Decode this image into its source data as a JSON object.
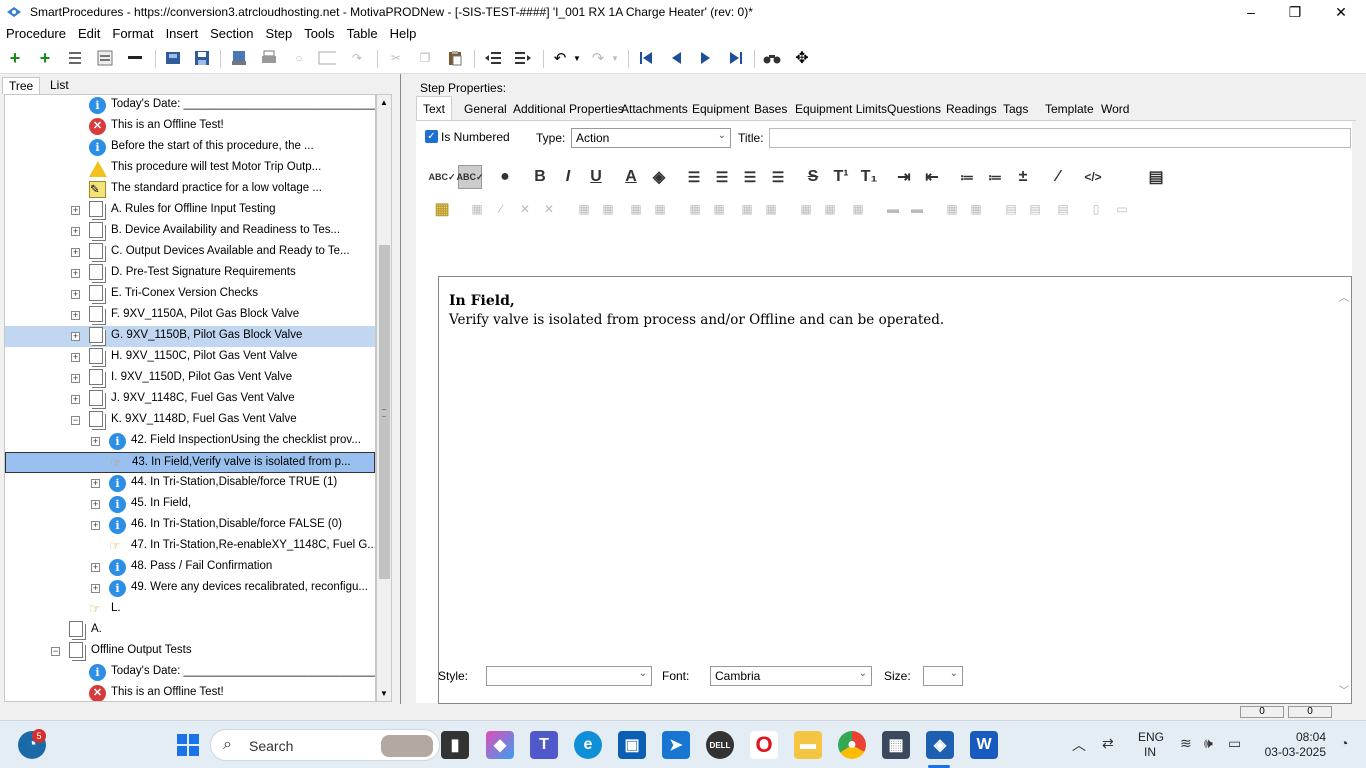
{
  "window": {
    "title": "SmartProcedures - https://conversion3.atrcloudhosting.net - MotivaPRODNew - [-SIS-TEST-####] 'I_001 RX 1A Charge Heater' (rev: 0)*",
    "minimize": "–",
    "restore": "❐",
    "close": "✕"
  },
  "menu": [
    "Procedure",
    "Edit",
    "Format",
    "Insert",
    "Section",
    "Step",
    "Tools",
    "Table",
    "Help"
  ],
  "toolbar_icons": [
    "add-icon",
    "add-child-icon",
    "outdent-icon",
    "properties-icon",
    "delete-icon",
    "open-icon",
    "save-icon",
    "export-icon",
    "print-icon",
    "refresh-icon",
    "image-icon",
    "redo-icon",
    "cut-icon",
    "copy-icon",
    "paste-icon",
    "indent-left-icon",
    "indent-right-icon",
    "undo-icon",
    "redo-icon",
    "first-icon",
    "prev-icon",
    "next-icon",
    "last-icon",
    "binoculars-icon",
    "move-icon"
  ],
  "left_tabs": {
    "tree": "Tree",
    "list": "List"
  },
  "tree": [
    {
      "icon": "info",
      "label": "Today's Date: ______________________________...",
      "indent": 2
    },
    {
      "icon": "error",
      "label": "This is an Offline Test!",
      "indent": 2
    },
    {
      "icon": "info",
      "label": "Before the start of this procedure, the ...",
      "indent": 2
    },
    {
      "icon": "warning",
      "label": "This procedure will test Motor Trip Outp...",
      "indent": 2
    },
    {
      "icon": "pen",
      "label": "The standard practice for a low voltage ...",
      "indent": 2
    },
    {
      "icon": "page",
      "label": "A. Rules for Offline Input Testing",
      "indent": 2,
      "exp": "+"
    },
    {
      "icon": "page",
      "label": "B. Device Availability and Readiness to Tes...",
      "indent": 2,
      "exp": "+"
    },
    {
      "icon": "page",
      "label": "C. Output Devices Available and Ready to Te...",
      "indent": 2,
      "exp": "+"
    },
    {
      "icon": "page",
      "label": "D. Pre-Test Signature Requirements",
      "indent": 2,
      "exp": "+"
    },
    {
      "icon": "page",
      "label": "E. Tri-Conex Version Checks",
      "indent": 2,
      "exp": "+"
    },
    {
      "icon": "page",
      "label": "F. 9XV_1150A, Pilot Gas Block Valve",
      "indent": 2,
      "exp": "+"
    },
    {
      "icon": "page",
      "label": "G. 9XV_1150B, Pilot Gas Block Valve",
      "indent": 2,
      "exp": "+",
      "sel": "g"
    },
    {
      "icon": "page",
      "label": "H. 9XV_1150C, Pilot Gas Vent Valve",
      "indent": 2,
      "exp": "+"
    },
    {
      "icon": "page",
      "label": "I. 9XV_1150D, Pilot Gas Vent Valve",
      "indent": 2,
      "exp": "+"
    },
    {
      "icon": "page",
      "label": "J. 9XV_1148C, Fuel Gas Vent Valve",
      "indent": 2,
      "exp": "+"
    },
    {
      "icon": "page",
      "label": "K. 9XV_1148D, Fuel Gas Vent Valve",
      "indent": 2,
      "exp": "−"
    },
    {
      "icon": "info",
      "label": "42. Field InspectionUsing the checklist prov...",
      "indent": 3,
      "exp": "+"
    },
    {
      "icon": "hand",
      "label": "43. In Field,Verify valve is isolated from p...",
      "indent": 3,
      "sel": "43"
    },
    {
      "icon": "info",
      "label": "44. In Tri-Station,Disable/force TRUE (1)",
      "indent": 3,
      "exp": "+"
    },
    {
      "icon": "info",
      "label": "45. In Field,",
      "indent": 3,
      "exp": "+"
    },
    {
      "icon": "info",
      "label": "46. In Tri-Station,Disable/force FALSE (0)",
      "indent": 3,
      "exp": "+"
    },
    {
      "icon": "hand",
      "label": "47. In Tri-Station,Re-enableXY_1148C, Fuel G...",
      "indent": 3
    },
    {
      "icon": "info",
      "label": "48. Pass / Fail Confirmation",
      "indent": 3,
      "exp": "+"
    },
    {
      "icon": "info",
      "label": "49. Were any devices recalibrated, reconfigu...",
      "indent": 3,
      "exp": "+"
    },
    {
      "icon": "hand",
      "label": "L.",
      "indent": 2
    },
    {
      "icon": "page",
      "label": "A.",
      "indent": 1
    },
    {
      "icon": "page",
      "label": "Offline Output Tests",
      "indent": 1,
      "exp": "−"
    },
    {
      "icon": "info",
      "label": "Today's Date: ______________________________...",
      "indent": 2
    },
    {
      "icon": "error",
      "label": "This is an Offline Test!",
      "indent": 2
    }
  ],
  "step_properties": {
    "heading": "Step Properties:",
    "tabs": [
      "Text",
      "General",
      "Additional Properties",
      "Attachments",
      "Equipment",
      "Bases",
      "Equipment Limits",
      "Questions",
      "Readings",
      "Tags",
      "Template",
      "Word"
    ],
    "is_numbered_label": "Is Numbered",
    "is_numbered": true,
    "type_label": "Type:",
    "type_value": "Action",
    "title_label": "Title:",
    "title_value": ""
  },
  "editor": {
    "line1": "In Field,",
    "line2": "Verify valve is isolated from process and/or Offline and can be operated."
  },
  "format_bar": {
    "style_label": "Style:",
    "style_value": "",
    "font_label": "Font:",
    "font_value": "Cambria",
    "size_label": "Size:",
    "size_value": ""
  },
  "status": {
    "left": "0",
    "right": "0"
  },
  "taskbar": {
    "search_placeholder": "Search",
    "notification_count": "5",
    "lang_line1": "ENG",
    "lang_line2": "IN",
    "time": "08:04",
    "date": "03-03-2025"
  }
}
